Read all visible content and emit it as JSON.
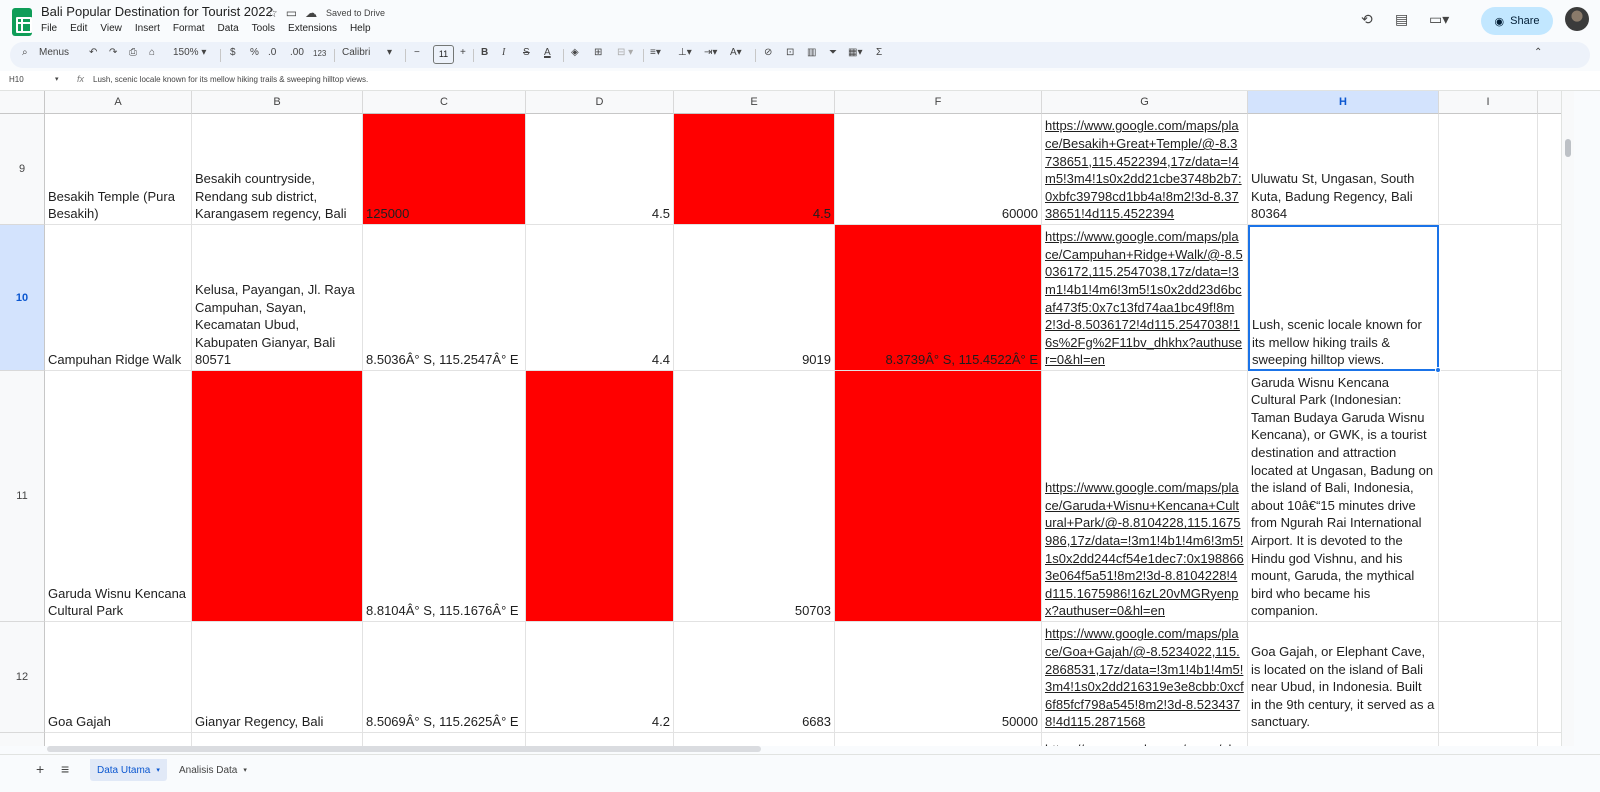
{
  "document": {
    "title": "Bali Popular Destination for Tourist 2022",
    "saved_status": "Saved to Drive",
    "menu": [
      "File",
      "Edit",
      "View",
      "Insert",
      "Format",
      "Data",
      "Tools",
      "Extensions",
      "Help"
    ],
    "share_label": "Share"
  },
  "toolbar": {
    "menus_label": "Menus",
    "zoom": "150%",
    "currency": "$",
    "percent": "%",
    "dec_decrease": ".0",
    "dec_increase": ".00",
    "number_format": "123",
    "font_name": "Calibri",
    "font_size": "11",
    "minus": "−",
    "plus": "+",
    "bold": "B",
    "italic": "I",
    "strike": "S",
    "text_color": "A",
    "sigma": "Σ"
  },
  "formula_bar": {
    "name_box": "H10",
    "fx": "fx",
    "content": "Lush, scenic locale known for its mellow hiking trails & sweeping hilltop views."
  },
  "columns": [
    "A",
    "B",
    "C",
    "D",
    "E",
    "F",
    "G",
    "H",
    "I"
  ],
  "rows": [
    {
      "num": "9",
      "cells": {
        "A": "Besakih Temple (Pura Besakih)",
        "B": "Besakih countryside, Rendang sub district, Karangasem regency, Bali",
        "C": "125000",
        "D": "4.5",
        "E": "4.5",
        "F": "60000",
        "G": "https://www.google.com/maps/place/Besakih+Great+Temple/@-8.3738651,115.4522394,17z/data=!4m5!3m4!1s0x2dd21cbe3748b2b7:0xbfc39798cd1bb4a!8m2!3d-8.3738651!4d115.4522394",
        "H": "Uluwatu St, Ungasan, South Kuta, Badung Regency, Bali 80364",
        "I": ""
      }
    },
    {
      "num": "10",
      "cells": {
        "A": "Campuhan Ridge Walk",
        "B": "Kelusa, Payangan, Jl. Raya Campuhan, Sayan, Kecamatan Ubud, Kabupaten Gianyar, Bali 80571",
        "C": "8.5036Â° S, 115.2547Â° E",
        "D": "4.4",
        "E": "9019",
        "F": "8.3739Â° S, 115.4522Â° E",
        "G": "https://www.google.com/maps/place/Campuhan+Ridge+Walk/@-8.5036172,115.2547038,17z/data=!3m1!4b1!4m6!3m5!1s0x2dd23d6bcaf473f5:0x7c13fd74aa1bc49f!8m2!3d-8.5036172!4d115.2547038!16s%2Fg%2F11bv_dhkhx?authuser=0&hl=en",
        "H": "Lush, scenic locale known for its mellow hiking trails & sweeping hilltop views.",
        "I": ""
      }
    },
    {
      "num": "11",
      "cells": {
        "A": "Garuda Wisnu Kencana Cultural Park",
        "B": "",
        "C": "8.8104Â° S, 115.1676Â° E",
        "D": "",
        "E": "50703",
        "F": "",
        "G": "https://www.google.com/maps/place/Garuda+Wisnu+Kencana+Cultural+Park/@-8.8104228,115.1675986,17z/data=!3m1!4b1!4m6!3m5!1s0x2dd244cf54e1dec7:0x1988663e064f5a51!8m2!3d-8.8104228!4d115.1675986!16zL20vMGRyenpx?authuser=0&hl=en",
        "H": "Garuda Wisnu Kencana Cultural Park (Indonesian: Taman Budaya Garuda Wisnu Kencana), or GWK, is a tourist destination and attraction located at Ungasan, Badung on the island of Bali, Indonesia, about 10â€“15 minutes drive from Ngurah Rai International Airport. It is devoted to the Hindu god Vishnu, and his mount, Garuda, the mythical bird who became his companion.",
        "I": ""
      }
    },
    {
      "num": "12",
      "cells": {
        "A": "Goa Gajah",
        "B": "Gianyar Regency, Bali",
        "C": "8.5069Â° S, 115.2625Â° E",
        "D": "4.2",
        "E": "6683",
        "F": "50000",
        "G": "https://www.google.com/maps/place/Goa+Gajah/@-8.5234022,115.2868531,17z/data=!3m1!4b1!4m5!3m4!1s0x2dd216319e3e8cbb:0xcf6f85fcf798a545!8m2!3d-8.5234378!4d115.2871568",
        "H": "Goa Gajah, or Elephant Cave, is located on the island of Bali near Ubud, in Indonesia. Built in the 9th century, it served as a sanctuary.",
        "I": ""
      }
    },
    {
      "num": "",
      "cells": {
        "A": "",
        "B": "",
        "C": "",
        "D": "",
        "E": "",
        "F": "",
        "G": "https://www.google.com/maps/pl",
        "H": "",
        "I": ""
      }
    }
  ],
  "red_cells": [
    "9C",
    "9E",
    "10F",
    "11B",
    "11D",
    "11F"
  ],
  "numeric_columns": [
    "D",
    "E",
    "F"
  ],
  "link_column": "G",
  "selected_cell": "10H",
  "colors": {
    "red_fill": "#ff0000",
    "selection": "#1a73e8",
    "share_bg": "#c2e7ff"
  },
  "sheets": [
    {
      "name": "Data Utama",
      "active": true
    },
    {
      "name": "Analisis Data",
      "active": false
    }
  ]
}
